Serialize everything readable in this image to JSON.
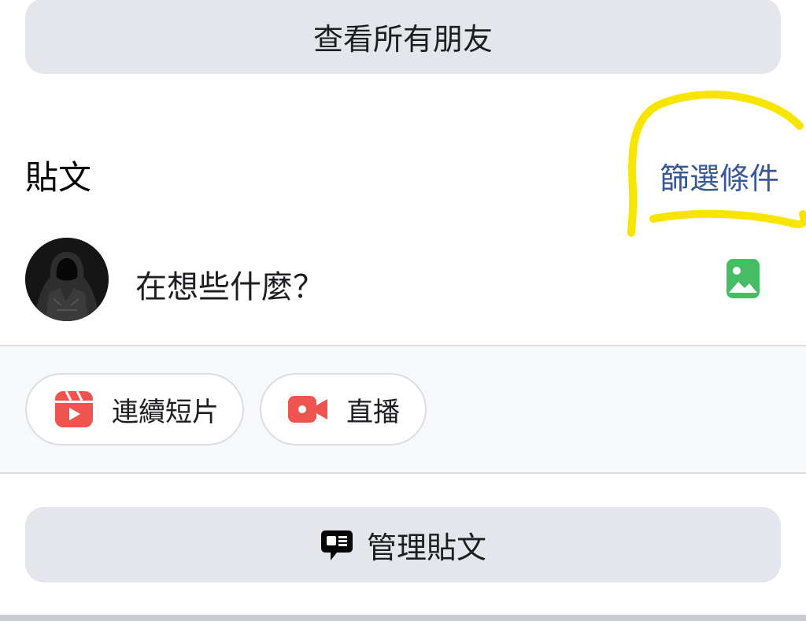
{
  "friends": {
    "see_all_label": "查看所有朋友"
  },
  "posts": {
    "title": "貼文",
    "filter_label": "篩選條件"
  },
  "composer": {
    "prompt": "在想些什麼？",
    "avatar_icon": "hooded-figure-avatar",
    "photo_icon": "photo-icon",
    "photo_icon_color": "#45bd62"
  },
  "quick_actions": [
    {
      "label": "連續短片",
      "icon": "reels-icon",
      "color": "#f0544f"
    },
    {
      "label": "直播",
      "icon": "live-video-icon",
      "color": "#f0544f"
    }
  ],
  "manage": {
    "label": "管理貼文",
    "icon": "chat-bubble-icon"
  },
  "annotation": {
    "color": "#f7e500"
  }
}
